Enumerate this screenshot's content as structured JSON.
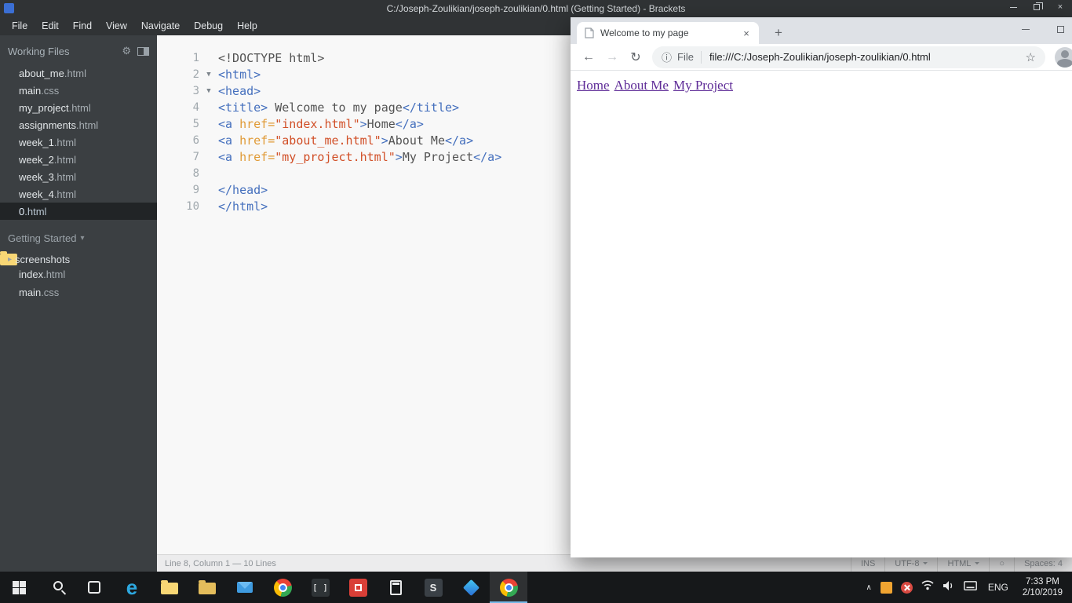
{
  "icons": {
    "gear": "⚙",
    "caret_down": "▾",
    "caret_right": "▸",
    "fold_open": "▼",
    "lint_ok": "○",
    "tab_close": "×",
    "new_tab": "+",
    "back": "←",
    "forward": "→",
    "reload": "↻",
    "info": "ⓘ",
    "star": "☆",
    "win_close": "×",
    "tray_chevron": "∧",
    "edge_letter": "e",
    "brackets_glyph": "[ ]",
    "s_app_letter": "S"
  },
  "colors": {
    "visited_link": "#5e2b97",
    "syntax_tag": "#446fbd",
    "syntax_attr": "#e09a36",
    "syntax_string": "#d14f27"
  },
  "brackets": {
    "window_title": "C:/Joseph-Zoulikian/joseph-zoulikian/0.html (Getting Started) - Brackets",
    "menu_items": [
      "File",
      "Edit",
      "Find",
      "View",
      "Navigate",
      "Debug",
      "Help"
    ],
    "sidebar": {
      "working_files_label": "Working Files",
      "working_files": [
        {
          "base": "about_me",
          "ext": ".html",
          "active": false
        },
        {
          "base": "main",
          "ext": ".css",
          "active": false
        },
        {
          "base": "my_project",
          "ext": ".html",
          "active": false
        },
        {
          "base": "assignments",
          "ext": ".html",
          "active": false
        },
        {
          "base": "week_1",
          "ext": ".html",
          "active": false
        },
        {
          "base": "week_2",
          "ext": ".html",
          "active": false
        },
        {
          "base": "week_3",
          "ext": ".html",
          "active": false
        },
        {
          "base": "week_4",
          "ext": ".html",
          "active": false
        },
        {
          "base": "0",
          "ext": ".html",
          "active": true
        }
      ],
      "project_label": "Getting Started",
      "project_tree": [
        {
          "type": "folder",
          "label": "screenshots"
        },
        {
          "type": "file",
          "base": "index",
          "ext": ".html"
        },
        {
          "type": "file",
          "base": "main",
          "ext": ".css"
        }
      ]
    },
    "editor": {
      "lines": [
        {
          "n": "1",
          "fold": false,
          "segs": [
            {
              "c": "plain",
              "s": "<!DOCTYPE html>"
            }
          ]
        },
        {
          "n": "2",
          "fold": true,
          "segs": [
            {
              "c": "tag",
              "s": "<html>"
            }
          ]
        },
        {
          "n": "3",
          "fold": true,
          "segs": [
            {
              "c": "tag",
              "s": "<head>"
            }
          ]
        },
        {
          "n": "4",
          "fold": false,
          "segs": [
            {
              "c": "tag",
              "s": "<title>"
            },
            {
              "c": "plain",
              "s": " Welcome to my page"
            },
            {
              "c": "tag",
              "s": "</title>"
            }
          ]
        },
        {
          "n": "5",
          "fold": false,
          "segs": [
            {
              "c": "tag",
              "s": "<a"
            },
            {
              "c": "attr",
              "s": " href="
            },
            {
              "c": "str",
              "s": "\"index.html\""
            },
            {
              "c": "tag",
              "s": ">"
            },
            {
              "c": "plain",
              "s": "Home"
            },
            {
              "c": "tag",
              "s": "</a>"
            }
          ]
        },
        {
          "n": "6",
          "fold": false,
          "segs": [
            {
              "c": "tag",
              "s": "<a"
            },
            {
              "c": "attr",
              "s": " href="
            },
            {
              "c": "str",
              "s": "\"about_me.html\""
            },
            {
              "c": "tag",
              "s": ">"
            },
            {
              "c": "plain",
              "s": "About Me"
            },
            {
              "c": "tag",
              "s": "</a>"
            }
          ]
        },
        {
          "n": "7",
          "fold": false,
          "segs": [
            {
              "c": "tag",
              "s": "<a"
            },
            {
              "c": "attr",
              "s": " href="
            },
            {
              "c": "str",
              "s": "\"my_project.html\""
            },
            {
              "c": "tag",
              "s": ">"
            },
            {
              "c": "plain",
              "s": "My Project"
            },
            {
              "c": "tag",
              "s": "</a>"
            }
          ]
        },
        {
          "n": "8",
          "fold": false,
          "segs": []
        },
        {
          "n": "9",
          "fold": false,
          "segs": [
            {
              "c": "tag",
              "s": "</head>"
            }
          ]
        },
        {
          "n": "10",
          "fold": false,
          "segs": [
            {
              "c": "tag",
              "s": "</html>"
            }
          ]
        }
      ]
    },
    "statusbar": {
      "cursor_info": "Line 8, Column 1 — 10 Lines",
      "overwrite": "INS",
      "encoding": "UTF-8",
      "language": "HTML",
      "indent_label": "Spaces:",
      "indent_value": "4"
    }
  },
  "chrome": {
    "tab_title": "Welcome to my page",
    "security_chip": "File",
    "url": "file:///C:/Joseph-Zoulikian/joseph-zoulikian/0.html",
    "page_links": [
      {
        "label": "Home"
      },
      {
        "label": "About Me"
      },
      {
        "label": "My Project"
      }
    ]
  },
  "taskbar": {
    "language": "ENG",
    "time": "7:33 PM",
    "date": "2/10/2019"
  }
}
